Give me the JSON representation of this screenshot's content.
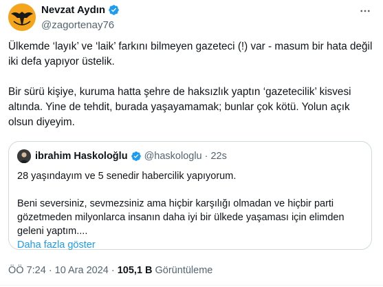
{
  "author": {
    "name": "Nevzat Aydın",
    "handle": "@zagortenay76"
  },
  "tweet": {
    "paragraphs": [
      "Ülkemde ‘layık’ ve ‘laik’ farkını bilmeyen gazeteci (!) var - masum bir hata değil iki defa yapıyor üstelik.",
      "Bir sürü kişiye, kuruma hatta şehre de haksızlık yaptın ‘gazetecilik’ kisvesi altında. Yine de tehdit, burada yaşayamamak; bunlar çok kötü. Yolun açık olsun diyeyim."
    ]
  },
  "quote": {
    "name": "ibrahim Haskoloğlu",
    "handle": "@haskologlu",
    "separator": "·",
    "time": "22s",
    "paragraphs": [
      "28 yaşındayım ve 5 senedir habercilik yapıyorum.",
      "Beni seversiniz, sevmezsiniz ama hiçbir karşılığı olmadan ve hiçbir parti gözetmeden milyonlarca insanın daha iyi bir ülkede yaşaması için elimden geleni yaptım...."
    ],
    "show_more": "Daha fazla göster"
  },
  "footer": {
    "time": "ÖÖ 7:24",
    "separator": "·",
    "date": "10 Ara 2024",
    "views_count": "105,1 B",
    "views_label": "Görüntüleme"
  },
  "icons": {
    "verified": "verified-badge-icon",
    "more": "more-horizontal-icon"
  },
  "colors": {
    "accent": "#1d9bf0",
    "text": "#0f1419",
    "muted": "#536471",
    "border": "#cfd9de"
  }
}
